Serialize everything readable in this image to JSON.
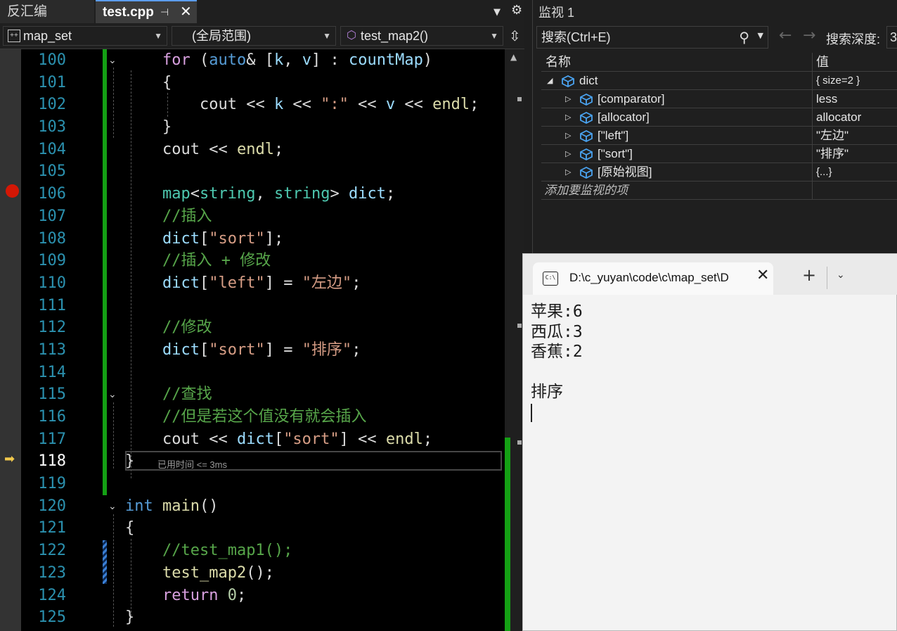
{
  "editor": {
    "tabs": {
      "inactive_label": "反汇编",
      "active_label": "test.cpp",
      "pin_glyph": "⊣",
      "close_glyph": "✕"
    },
    "nav": {
      "project": "map_set",
      "scope": "(全局范围)",
      "function": "test_map2()"
    },
    "line_numbers": [
      "100",
      "101",
      "102",
      "103",
      "104",
      "105",
      "106",
      "107",
      "108",
      "109",
      "110",
      "111",
      "112",
      "113",
      "114",
      "115",
      "116",
      "117",
      "118",
      "119",
      "120",
      "121",
      "122",
      "123",
      "124",
      "125"
    ],
    "current_line": "118",
    "perf_tip": "已用时间 <= 3ms",
    "code": {
      "l100_for": "for",
      "l100_auto": "auto",
      "l100_k": "k",
      "l100_v": "v",
      "l100_map": "countMap",
      "l101": "{",
      "l102_cout": "cout",
      "l102_k": "k",
      "l102_str": "\":\"",
      "l102_v": "v",
      "l102_endl": "endl",
      "l103": "}",
      "l104_cout": "cout",
      "l104_endl": "endl",
      "l106_map": "map",
      "l106_string1": "string",
      "l106_string2": "string",
      "l106_dict": "dict",
      "l107": "//插入",
      "l108_dict": "dict",
      "l108_str": "\"sort\"",
      "l109": "//插入 + 修改",
      "l110_dict": "dict",
      "l110_key": "\"left\"",
      "l110_val": "\"左边\"",
      "l112": "//修改",
      "l113_dict": "dict",
      "l113_key": "\"sort\"",
      "l113_val": "\"排序\"",
      "l115": "//查找",
      "l116": "//但是若这个值没有就会插入",
      "l117_cout": "cout",
      "l117_dict": "dict",
      "l117_key": "\"sort\"",
      "l117_endl": "endl",
      "l118": "}",
      "l120_int": "int",
      "l120_main": "main",
      "l121": "{",
      "l122": "//test_map1();",
      "l123_fn": "test_map2",
      "l124_ret": "return",
      "l124_num": "0",
      "l125": "}"
    }
  },
  "watch": {
    "title": "监视 1",
    "search_placeholder": "搜索(Ctrl+E)",
    "depth_label": "搜索深度:",
    "depth_value": "3",
    "col_name": "名称",
    "col_value": "值",
    "rows": [
      {
        "name": "dict",
        "value": "{ size=2 }"
      },
      {
        "name": "[comparator]",
        "value": "less"
      },
      {
        "name": "[allocator]",
        "value": "allocator"
      },
      {
        "name": "[\"left\"]",
        "value": "\"左边\""
      },
      {
        "name": "[\"sort\"]",
        "value": "\"排序\""
      },
      {
        "name": "[原始视图]",
        "value": "{...}"
      }
    ],
    "add_item": "添加要监视的项"
  },
  "terminal": {
    "title": "D:\\c_yuyan\\code\\c\\map_set\\D",
    "icon_text": "C:\\",
    "output": [
      "苹果:6",
      "西瓜:3",
      "香蕉:2",
      "",
      "排序"
    ]
  },
  "colors": {
    "keyword": "#569cd6",
    "comment": "#57a64a",
    "string": "#d69d85",
    "function": "#dcdcaa",
    "type": "#4ec9b0",
    "breakpoint": "#e51400",
    "change_bar": "#14a014"
  },
  "icons": {
    "breakpoint": "breakpoint-icon",
    "instruction_pointer": "current-statement-arrow-icon",
    "fold": "collapse-icon",
    "watch_item": "object-cube-icon",
    "search": "search-icon"
  }
}
